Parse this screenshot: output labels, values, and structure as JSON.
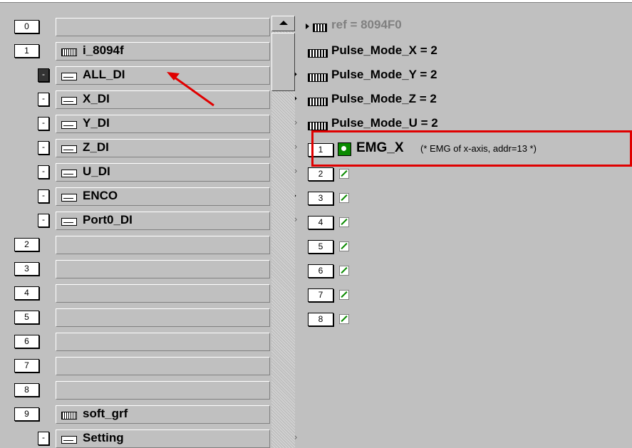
{
  "tree": {
    "rows": [
      {
        "num": "0",
        "label": "",
        "signal": ""
      },
      {
        "num": "1",
        "label": "i_8094f",
        "signal": ""
      },
      {
        "num": "-",
        "label": "ALL_DI",
        "signal": "⎍ ◆"
      },
      {
        "num": "-",
        "label": "X_DI",
        "signal": "⎍ ◆"
      },
      {
        "num": "-",
        "label": "Y_DI",
        "signal": "⎍ ◇"
      },
      {
        "num": "-",
        "label": "Z_DI",
        "signal": "⎍ ◇"
      },
      {
        "num": "-",
        "label": "U_DI",
        "signal": "⎍ ◇"
      },
      {
        "num": "-",
        "label": "ENCO",
        "signal": "∿ ◆"
      },
      {
        "num": "-",
        "label": "Port0_DI",
        "signal": "⎍ ◇"
      },
      {
        "num": "2",
        "label": "",
        "signal": ""
      },
      {
        "num": "3",
        "label": "",
        "signal": ""
      },
      {
        "num": "4",
        "label": "",
        "signal": ""
      },
      {
        "num": "5",
        "label": "",
        "signal": ""
      },
      {
        "num": "6",
        "label": "",
        "signal": ""
      },
      {
        "num": "7",
        "label": "",
        "signal": ""
      },
      {
        "num": "8",
        "label": "",
        "signal": ""
      },
      {
        "num": "9",
        "label": "soft_grf",
        "signal": ""
      },
      {
        "num": "-",
        "label": "Setting",
        "signal": "⎍ ◇"
      }
    ]
  },
  "params": {
    "ref": "ref = 8094F0",
    "items": [
      "Pulse_Mode_X = 2",
      "Pulse_Mode_Y = 2",
      "Pulse_Mode_Z = 2",
      "Pulse_Mode_U = 2"
    ]
  },
  "channels": {
    "emg": {
      "num": "1",
      "name": "EMG_X",
      "comment": "(* EMG of x-axis, addr=13 *)"
    },
    "nums": [
      "2",
      "3",
      "4",
      "5",
      "6",
      "7",
      "8"
    ]
  },
  "colors": {
    "highlight": "#e00000",
    "icon_green": "#0a8a00",
    "background": "#c0c0c0"
  }
}
